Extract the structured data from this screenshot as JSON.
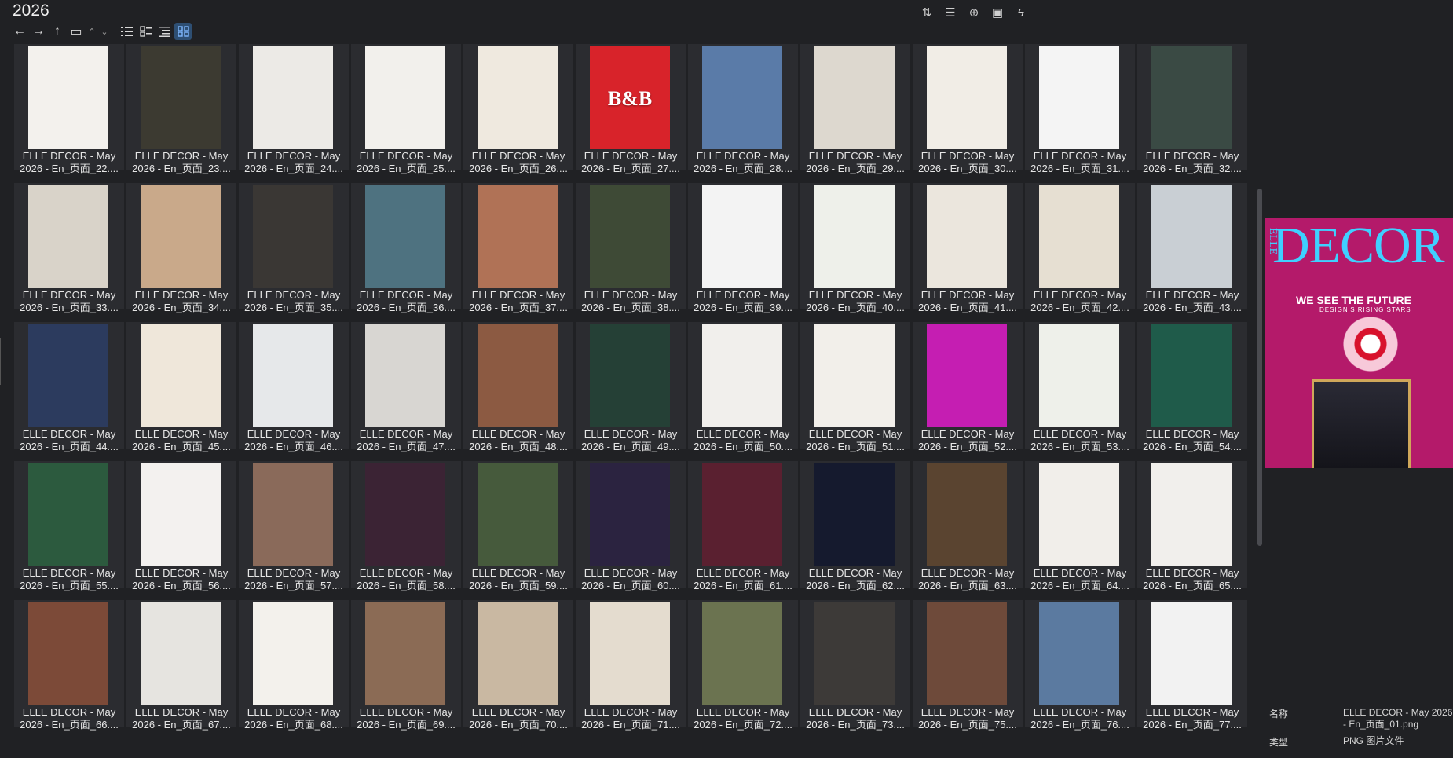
{
  "window": {
    "title": "2026"
  },
  "nav": {
    "back": "←",
    "forward": "→",
    "up": "↑",
    "folder": "▭",
    "collapse": "⌃",
    "collapse_small": "⌄"
  },
  "view_modes": [
    "details",
    "list",
    "tiles",
    "thumbnails"
  ],
  "active_view": "thumbnails",
  "toolbar_icons": [
    "sort-icon",
    "columns-icon",
    "add-icon",
    "clipboard-icon",
    "flash-icon"
  ],
  "caption_prefix": "ELLE DECOR - May",
  "caption_second_prefix": "2026 - En_页面_",
  "files": [
    {
      "num": "22",
      "c": "#f3f1ed"
    },
    {
      "num": "23",
      "c": "#3c3a31"
    },
    {
      "num": "24",
      "c": "#eceae6"
    },
    {
      "num": "25",
      "c": "#f2f0ec"
    },
    {
      "num": "26",
      "c": "#efe9df"
    },
    {
      "num": "27",
      "c": "#d8232a",
      "t": "B&B"
    },
    {
      "num": "28",
      "c": "#5a7ba8"
    },
    {
      "num": "29",
      "c": "#ddd8cf"
    },
    {
      "num": "30",
      "c": "#f1ede6"
    },
    {
      "num": "31",
      "c": "#f4f4f4"
    },
    {
      "num": "32",
      "c": "#3a4a44"
    },
    {
      "num": "33",
      "c": "#d9d3c9"
    },
    {
      "num": "34",
      "c": "#c9a98a"
    },
    {
      "num": "35",
      "c": "#3a3734"
    },
    {
      "num": "36",
      "c": "#4e7280"
    },
    {
      "num": "37",
      "c": "#b07256"
    },
    {
      "num": "38",
      "c": "#3e4a36"
    },
    {
      "num": "39",
      "c": "#f3f3f3"
    },
    {
      "num": "40",
      "c": "#eef0ea"
    },
    {
      "num": "41",
      "c": "#ebe6dd"
    },
    {
      "num": "42",
      "c": "#e6dfd2"
    },
    {
      "num": "43",
      "c": "#c9cfd4"
    },
    {
      "num": "44",
      "c": "#2c3b5e"
    },
    {
      "num": "45",
      "c": "#efe7da"
    },
    {
      "num": "46",
      "c": "#e6e8ea"
    },
    {
      "num": "47",
      "c": "#d8d6d2"
    },
    {
      "num": "48",
      "c": "#8c5a42"
    },
    {
      "num": "49",
      "c": "#254036"
    },
    {
      "num": "50",
      "c": "#f1efec"
    },
    {
      "num": "51",
      "c": "#f2efea"
    },
    {
      "num": "52",
      "c": "#c51eb2"
    },
    {
      "num": "53",
      "c": "#eef0ea"
    },
    {
      "num": "54",
      "c": "#1f5b4a"
    },
    {
      "num": "55",
      "c": "#2c5a3e"
    },
    {
      "num": "56",
      "c": "#f3f1ef"
    },
    {
      "num": "57",
      "c": "#8a6a5a"
    },
    {
      "num": "58",
      "c": "#3b2334"
    },
    {
      "num": "59",
      "c": "#465a3c"
    },
    {
      "num": "60",
      "c": "#2b2340"
    },
    {
      "num": "61",
      "c": "#5a2030"
    },
    {
      "num": "62",
      "c": "#151a2e"
    },
    {
      "num": "63",
      "c": "#5a4430"
    },
    {
      "num": "64",
      "c": "#f1eeea"
    },
    {
      "num": "65",
      "c": "#f1efec"
    },
    {
      "num": "66",
      "c": "#7c4a38"
    },
    {
      "num": "67",
      "c": "#e6e4e0"
    },
    {
      "num": "68",
      "c": "#f3f1ec"
    },
    {
      "num": "69",
      "c": "#8b6b55"
    },
    {
      "num": "70",
      "c": "#c9b8a2"
    },
    {
      "num": "71",
      "c": "#e4dccf"
    },
    {
      "num": "72",
      "c": "#6b7350"
    },
    {
      "num": "73",
      "c": "#3d3a38"
    },
    {
      "num": "75",
      "c": "#6e4a3a"
    },
    {
      "num": "76",
      "c": "#5b7aa0"
    },
    {
      "num": "77",
      "c": "#f2f2f2"
    }
  ],
  "preview": {
    "masthead": "DECOR",
    "brand": "ELLE",
    "cover_line": "WE SEE THE FUTURE",
    "cover_sub": "DESIGN'S RISING STARS"
  },
  "properties": [
    {
      "label": "名称",
      "value": "ELLE DECOR - May 2026 - En_页面_01.png"
    },
    {
      "label": "类型",
      "value": "PNG 图片文件"
    }
  ]
}
